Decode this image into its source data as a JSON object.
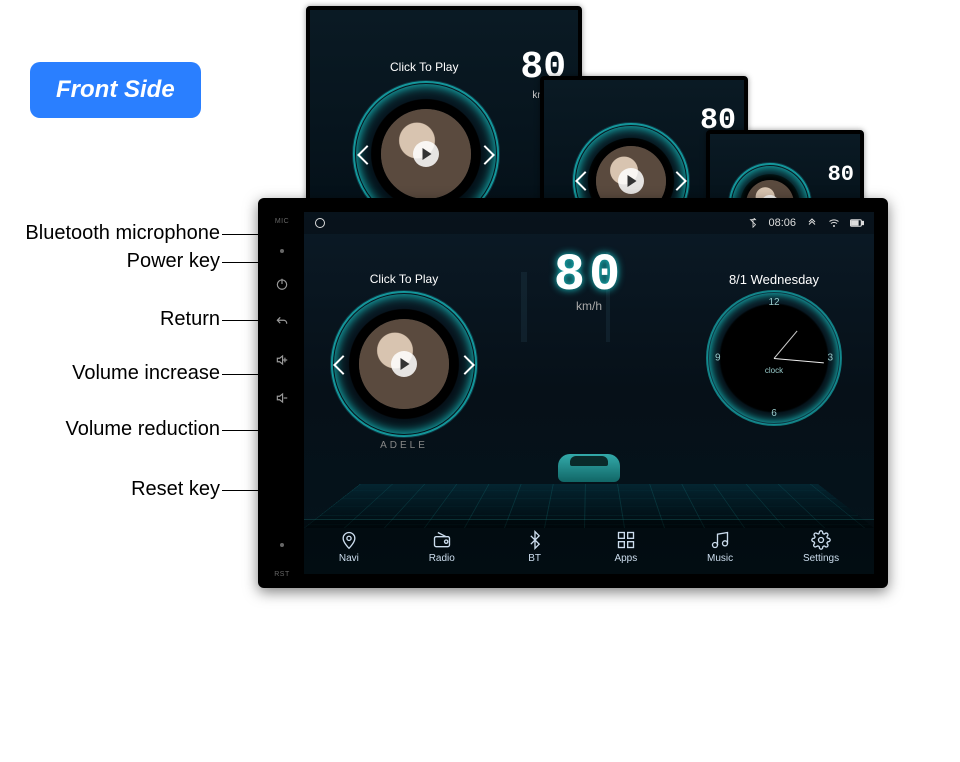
{
  "badge": {
    "label": "Front Side"
  },
  "labels": {
    "mic": "Bluetooth microphone",
    "power": "Power key",
    "return": "Return",
    "volup": "Volume increase",
    "voldown": "Volume reduction",
    "reset": "Reset key"
  },
  "sidepanel": {
    "mic_mark": "MIC",
    "rst_mark": "RST"
  },
  "player": {
    "click_to_play": "Click To Play",
    "album_artist": "ADELE"
  },
  "speed": {
    "value": "80",
    "unit": "km/h"
  },
  "clock": {
    "date_line": "8/1 Wednesday",
    "label": "clock",
    "n12": "12",
    "n3": "3",
    "n6": "6",
    "n9": "9"
  },
  "statusbar": {
    "time": "08:06"
  },
  "nav": {
    "items": [
      {
        "label": "Navi"
      },
      {
        "label": "Radio"
      },
      {
        "label": "BT"
      },
      {
        "label": "Apps"
      },
      {
        "label": "Music"
      },
      {
        "label": "Settings"
      }
    ]
  }
}
